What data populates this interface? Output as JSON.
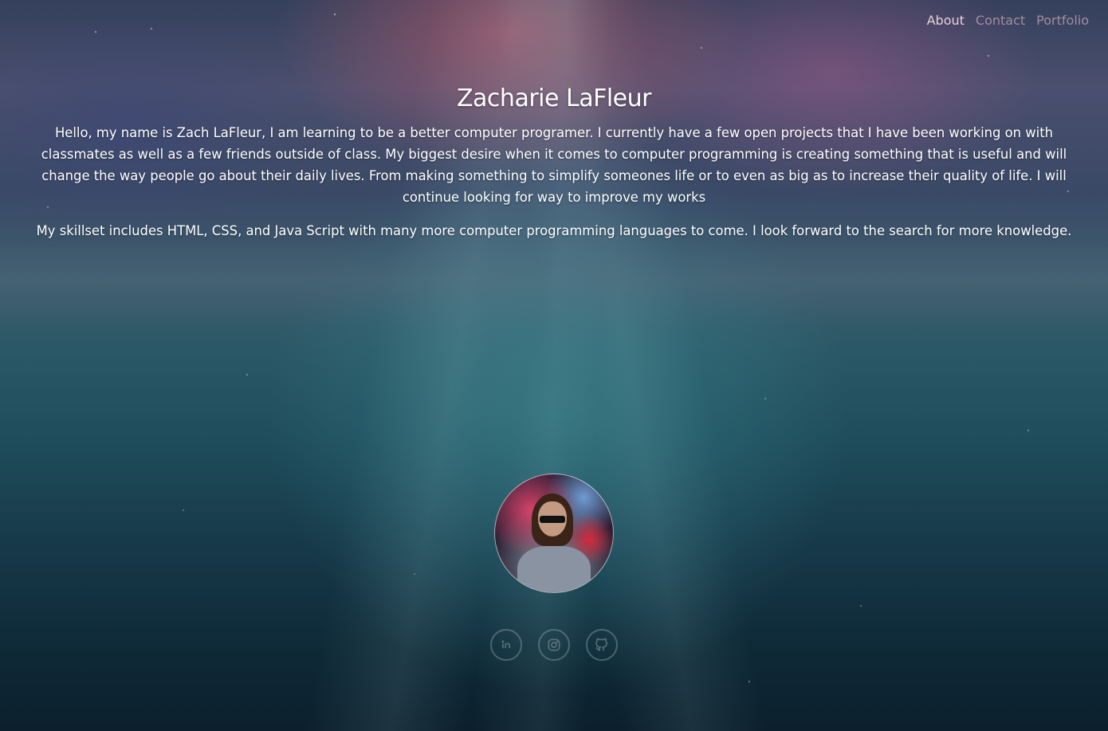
{
  "nav": {
    "items": [
      {
        "label": "About"
      },
      {
        "label": "Contact"
      },
      {
        "label": "Portfolio"
      }
    ]
  },
  "main": {
    "title": "Zacharie LaFleur",
    "paragraphs": [
      "Hello, my name is Zach LaFleur, I am learning to be a better computer programer. I currently have a few open projects that I have been working on with classmates as well as a few friends outside of class. My biggest desire when it comes to computer programming is creating something that is useful and will change the way people go about their daily lives. From making something to simplify someones life or to even as big as to increase their quality of life. I will continue looking for way to improve my works",
      "My skillset includes HTML, CSS, and Java Script with many more computer programming languages to come. I look forward to the search for more knowledge."
    ]
  },
  "socials": [
    {
      "icon": "linkedin-icon"
    },
    {
      "icon": "instagram-icon"
    },
    {
      "icon": "github-icon"
    }
  ]
}
